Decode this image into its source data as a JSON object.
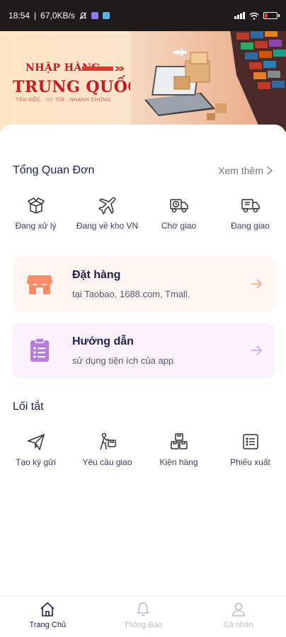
{
  "status_bar": {
    "time": "18:54",
    "speed": "67,0KB/s",
    "battery_level": 0.2
  },
  "banner": {
    "title_line1": "NHẬP HÀNG",
    "title_line2": "TRUNG QUỐC",
    "tagline": "TẬN GỐC · UY TÍN · NHANH CHÓNG"
  },
  "overview": {
    "title": "Tổng Quan Đơn",
    "see_more": "Xem thêm",
    "items": [
      {
        "label": "Đang xử lý",
        "icon": "box-open-icon"
      },
      {
        "label": "Đang về kho VN",
        "icon": "airplane-icon"
      },
      {
        "label": "Chờ giao",
        "icon": "truck-clock-icon"
      },
      {
        "label": "Đang giao",
        "icon": "delivery-truck-icon"
      }
    ]
  },
  "cards": {
    "order": {
      "title": "Đặt hàng",
      "subtitle": "tại Taobao, 1688.com, Tmall.",
      "color": "#ff8a65",
      "bg": "#fff6f1"
    },
    "guide": {
      "title": "Hướng dẫn",
      "subtitle": "sử dụng tiện ích của app",
      "color": "#b57be0",
      "bg": "#fbf2fe"
    }
  },
  "shortcuts": {
    "title": "Lối tắt",
    "items": [
      {
        "label": "Tạo ký gửi",
        "icon": "paper-plane-icon"
      },
      {
        "label": "Yêu cầu giao",
        "icon": "courier-icon"
      },
      {
        "label": "Kiện hàng",
        "icon": "boxes-icon"
      },
      {
        "label": "Phiếu xuất",
        "icon": "list-icon"
      }
    ]
  },
  "bottom_nav": {
    "items": [
      {
        "label": "Trang Chủ",
        "icon": "home-icon",
        "active": true
      },
      {
        "label": "Thông Báo",
        "icon": "bell-icon",
        "active": false
      },
      {
        "label": "Cá nhân",
        "icon": "user-icon",
        "active": false
      }
    ]
  }
}
